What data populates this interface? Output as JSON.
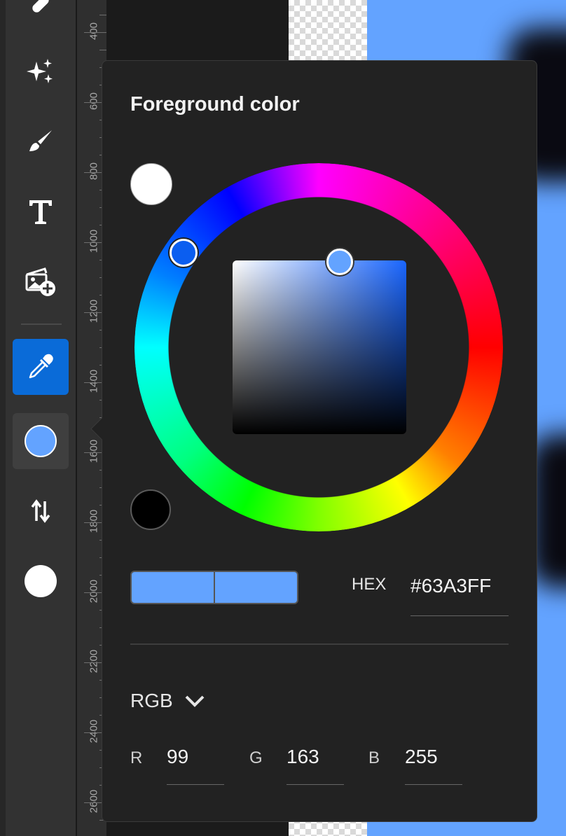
{
  "toolbar": {
    "tools": [
      {
        "name": "bandage-icon"
      },
      {
        "name": "sparkles-icon"
      },
      {
        "name": "brush-icon"
      },
      {
        "name": "text-tool-icon"
      },
      {
        "name": "add-image-icon"
      },
      {
        "name": "eyedropper-icon",
        "state": "active"
      },
      {
        "name": "foreground-swatch",
        "color": "#63A3FF",
        "state": "selected"
      },
      {
        "name": "swap-colors-icon"
      },
      {
        "name": "background-swatch",
        "color": "#FFFFFF"
      }
    ]
  },
  "ruler": {
    "labels": [
      "400",
      "600",
      "800",
      "1000",
      "1200",
      "1400",
      "1600",
      "1800",
      "2000",
      "2200",
      "2400",
      "2600"
    ]
  },
  "popover": {
    "title": "Foreground color",
    "foreground_swatch_color": "#FFFFFF",
    "background_swatch_color": "#000000",
    "selected_color": "#63A3FF",
    "hex": {
      "label": "HEX",
      "value": "#63A3FF"
    },
    "mode": {
      "selected": "RGB"
    },
    "channels": [
      {
        "label": "R",
        "value": "99"
      },
      {
        "label": "G",
        "value": "163"
      },
      {
        "label": "B",
        "value": "255"
      }
    ]
  },
  "colors": {
    "accent": "#0A6BD8",
    "panel": "#222222",
    "canvas_fill": "#63A3FF"
  }
}
